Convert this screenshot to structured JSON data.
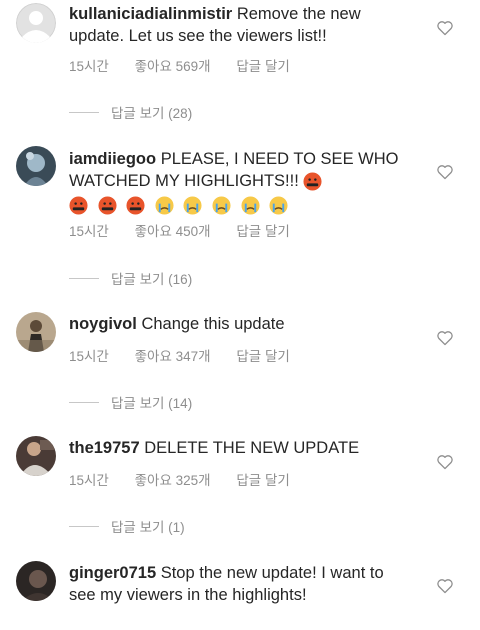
{
  "comments": [
    {
      "username": "kullaniciadialinmistir",
      "text": "Remove the new update. Let us see the viewers list!!",
      "time": "15시간",
      "likes": "좋아요 569개",
      "reply": "답글 달기",
      "view_replies": "답글 보기 (28)",
      "avatar_icon": "default-avatar-icon"
    },
    {
      "username": "iamdiiegoo",
      "text": "PLEASE, I NEED TO SEE WHO WATCHED MY HIGHLIGHTS!!!",
      "emoji_icons": [
        "angry-face-icon",
        "angry-face-icon",
        "angry-face-icon",
        "angry-face-icon",
        "crying-face-icon",
        "crying-face-icon",
        "crying-face-icon",
        "crying-face-icon",
        "crying-face-icon"
      ],
      "time": "15시간",
      "likes": "좋아요 450개",
      "reply": "답글 달기",
      "view_replies": "답글 보기 (16)"
    },
    {
      "username": "noygivol",
      "text": "Change this update",
      "time": "15시간",
      "likes": "좋아요 347개",
      "reply": "답글 달기",
      "view_replies": "답글 보기 (14)"
    },
    {
      "username": "the19757",
      "text": "DELETE THE NEW UPDATE",
      "time": "15시간",
      "likes": "좋아요 325개",
      "reply": "답글 달기",
      "view_replies": "답글 보기 (1)"
    },
    {
      "username": "ginger0715",
      "text": "Stop the new update! I want to see my viewers in the highlights!"
    }
  ],
  "colors": {
    "text": "#262626",
    "meta": "#8e8e8e",
    "line": "#c7c7c7",
    "angry": "#e8542b",
    "crying": "#f7c948"
  },
  "icons": {
    "like": "heart-outline-icon"
  }
}
